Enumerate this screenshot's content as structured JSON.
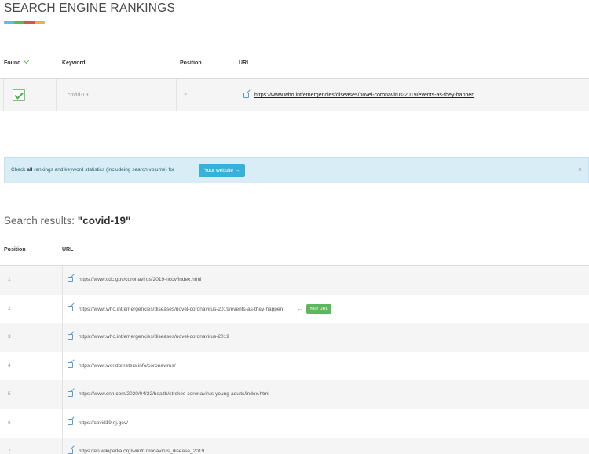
{
  "page": {
    "title": "SEARCH ENGINE RANKINGS",
    "underline_colors": [
      "#5bc0de",
      "#5cb85c",
      "#d9534f",
      "#f0ad4e"
    ]
  },
  "ranking": {
    "headers": {
      "found": "Found",
      "keyword": "Keyword",
      "position": "Position",
      "url": "URL"
    },
    "found_icon": "chevron-down-icon",
    "row": {
      "found": true,
      "keyword": "covid-19",
      "position": "2",
      "url": "https://www.who.int/emergencies/diseases/novel-coronavirus-2019/events-as-they-happen"
    }
  },
  "notice": {
    "text_before": "Check ",
    "text_bold": "all",
    "text_after": " rankings and keyword statistics (includeing search volume) for",
    "button": "Your website →",
    "close": "×"
  },
  "results": {
    "title_prefix": "Search results: ",
    "query": "\"covid-19\"",
    "headers": {
      "position": "Position",
      "url": "URL"
    },
    "your_url_arrow": "←",
    "your_url_badge": "Your URL",
    "rows": [
      {
        "position": "1",
        "url": "https://www.cdc.gov/coronavirus/2019-ncov/index.html"
      },
      {
        "position": "2",
        "url": "https://www.who.int/emergencies/diseases/novel-coronavirus-2019/events-as-they-happen"
      },
      {
        "position": "3",
        "url": "https://www.who.int/emergencies/diseases/novel-coronavirus-2019"
      },
      {
        "position": "4",
        "url": "https://www.worldometers.info/coronavirus/"
      },
      {
        "position": "5",
        "url": "https://www.cnn.com/2020/04/22/health/strokes-coronavirus-young-adults/index.html"
      },
      {
        "position": "6",
        "url": "https://covid19.nj.gov/"
      },
      {
        "position": "7",
        "url": "https://en.wikipedia.org/wiki/Coronavirus_disease_2019"
      }
    ]
  },
  "colors": {
    "accent_green": "#5cb85c",
    "notice_bg": "#d8edf5",
    "notice_button": "#36b2d8"
  }
}
